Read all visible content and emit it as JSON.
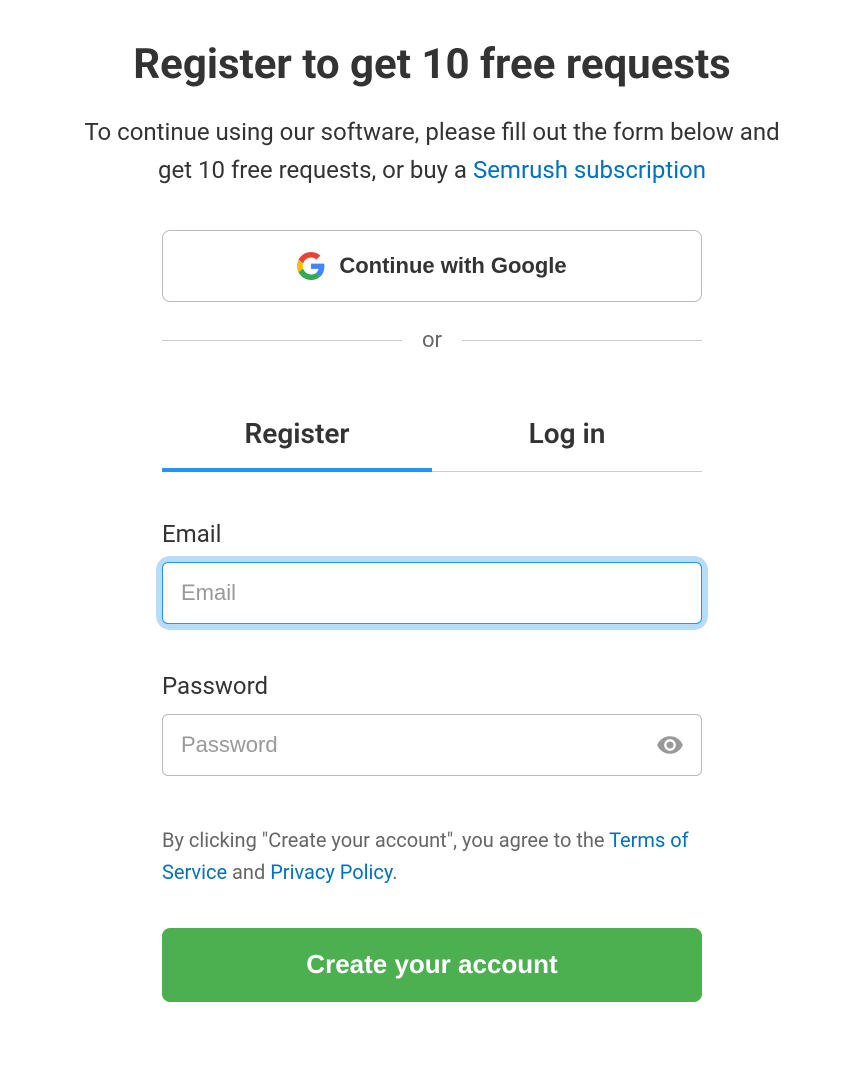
{
  "header": {
    "title": "Register to get 10 free requests",
    "subtitle_part1": "To continue using our software, please fill out the form below and get 10 free requests, or buy a ",
    "subscription_link": "Semrush subscription"
  },
  "oauth": {
    "google_label": "Continue with Google"
  },
  "divider": {
    "or_label": "or"
  },
  "tabs": {
    "register": "Register",
    "login": "Log in"
  },
  "form": {
    "email_label": "Email",
    "email_placeholder": "Email",
    "email_value": "",
    "password_label": "Password",
    "password_placeholder": "Password",
    "password_value": ""
  },
  "terms": {
    "prefix": "By clicking \"Create your account\", you agree to the ",
    "tos_link": "Terms of Service",
    "and": " and ",
    "privacy_link": "Privacy Policy",
    "suffix": "."
  },
  "submit": {
    "label": "Create your account"
  },
  "colors": {
    "primary_blue": "#2196f3",
    "link_blue": "#0071bc",
    "green_btn": "#4caf50",
    "focus_ring": "#b6dcf7"
  }
}
